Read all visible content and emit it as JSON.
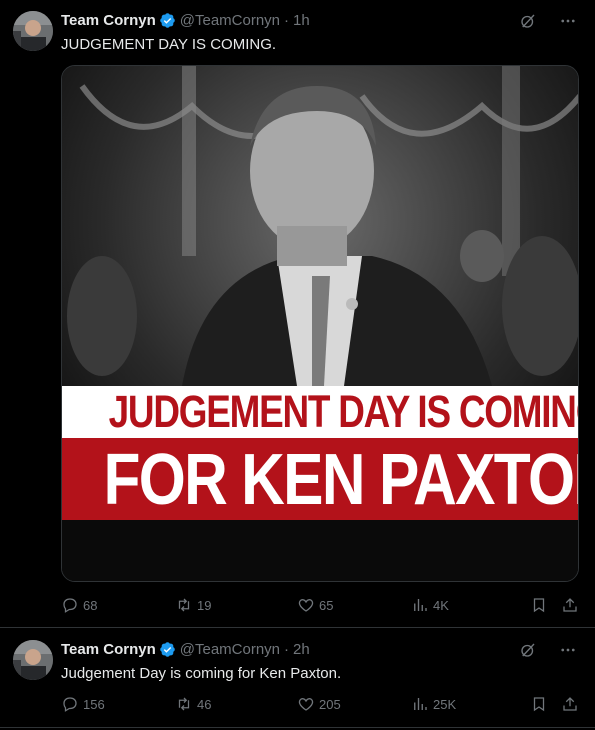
{
  "tweets": [
    {
      "name": "Team Cornyn",
      "handle": "@TeamCornyn",
      "time": "1h",
      "text": "JUDGEMENT DAY IS COMING.",
      "media": {
        "headline_line1": "JUDGEMENT DAY IS COMING",
        "headline_line2": "FOR KEN PAXTON."
      },
      "replies": "68",
      "retweets": "19",
      "likes": "65",
      "views": "4K"
    },
    {
      "name": "Team Cornyn",
      "handle": "@TeamCornyn",
      "time": "2h",
      "text": "Judgement Day is coming for Ken Paxton.",
      "replies": "156",
      "retweets": "46",
      "likes": "205",
      "views": "25K"
    }
  ],
  "separator": "·",
  "colors": {
    "background": "#000000",
    "text": "#e7e9ea",
    "muted": "#71767b",
    "verified": "#1d9bf0",
    "banner_red": "#b3121a",
    "divider": "#2f3336"
  },
  "icons": [
    "verified-badge-icon",
    "grok-icon",
    "more-icon",
    "reply-icon",
    "retweet-icon",
    "like-icon",
    "views-icon",
    "bookmark-icon",
    "share-icon"
  ]
}
